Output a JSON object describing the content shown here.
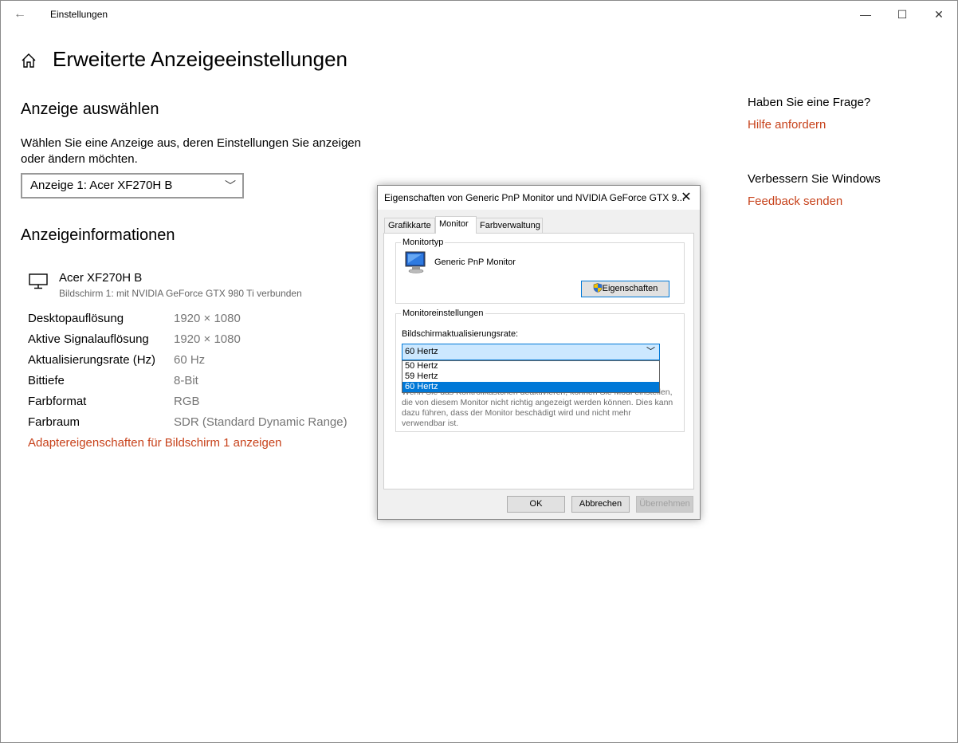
{
  "window": {
    "title": "Einstellungen",
    "back_glyph": "←",
    "min_glyph": "—",
    "max_glyph": "☐",
    "close_glyph": "✕"
  },
  "page": {
    "title": "Erweiterte Anzeigeeinstellungen"
  },
  "select_display": {
    "heading": "Anzeige auswählen",
    "description": "Wählen Sie eine Anzeige aus, deren Einstellungen Sie anzeigen oder ändern möchten.",
    "selected": "Anzeige 1: Acer XF270H B"
  },
  "display_info": {
    "heading": "Anzeigeinformationen",
    "monitor_name": "Acer XF270H B",
    "monitor_sub": "Bildschirm 1: mit NVIDIA GeForce GTX 980 Ti verbunden",
    "rows": [
      {
        "label": "Desktopauflösung",
        "value": "1920 × 1080"
      },
      {
        "label": "Aktive Signalauflösung",
        "value": "1920 × 1080"
      },
      {
        "label": "Aktualisierungsrate (Hz)",
        "value": "60 Hz"
      },
      {
        "label": "Bittiefe",
        "value": "8-Bit"
      },
      {
        "label": "Farbformat",
        "value": "RGB"
      },
      {
        "label": "Farbraum",
        "value": "SDR (Standard Dynamic Range)"
      }
    ],
    "adapter_link": "Adaptereigenschaften für Bildschirm 1 anzeigen"
  },
  "sidebar": {
    "question_heading": "Haben Sie eine Frage?",
    "help_link": "Hilfe anfordern",
    "improve_heading": "Verbessern Sie Windows",
    "feedback_link": "Feedback senden"
  },
  "dialog": {
    "title": "Eigenschaften von Generic PnP Monitor und NVIDIA GeForce GTX 9...",
    "tabs": [
      "Grafikkarte",
      "Monitor",
      "Farbverwaltung"
    ],
    "monitor_type_label": "Monitortyp",
    "monitor_type_name": "Generic PnP Monitor",
    "properties_button": "Eigenschaften",
    "monitor_settings_label": "Monitoreinstellungen",
    "refresh_label": "Bildschirmaktualisierungsrate:",
    "refresh_selected": "60 Hertz",
    "refresh_options": [
      "50 Hertz",
      "59 Hertz",
      "60 Hertz"
    ],
    "warning_text": "Wenn Sie das Kontrollkästchen deaktivieren, können Sie Modi einstellen, die von diesem Monitor nicht richtig angezeigt werden können. Dies kann dazu führen, dass der Monitor beschädigt wird und nicht mehr verwendbar ist.",
    "ok": "OK",
    "cancel": "Abbrechen",
    "apply": "Übernehmen"
  },
  "colors": {
    "accent": "#c7421b",
    "selection": "#0078d7"
  }
}
